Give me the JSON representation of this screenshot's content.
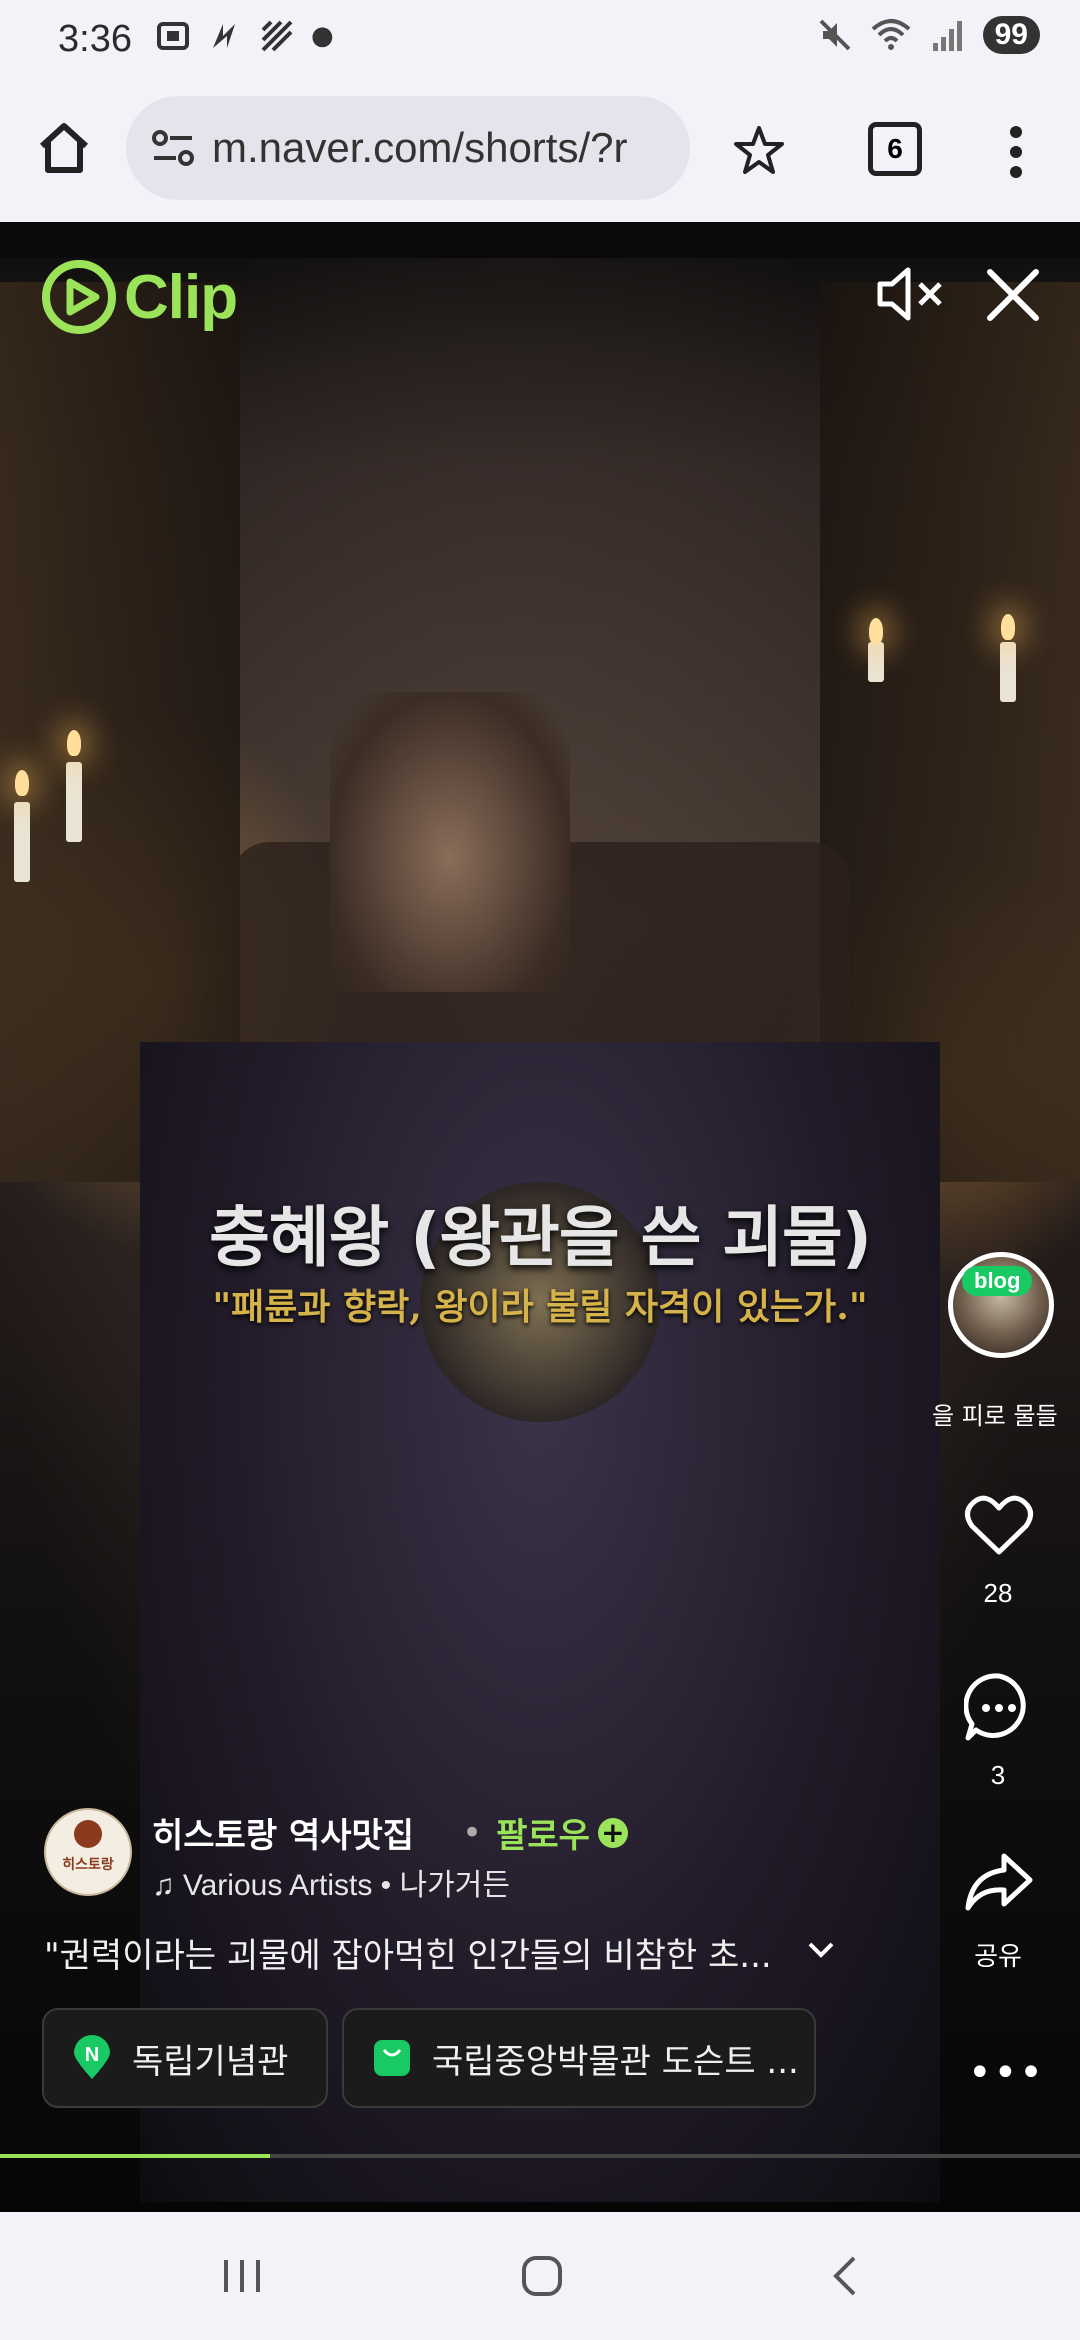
{
  "status_bar": {
    "time": "3:36",
    "battery": "99"
  },
  "browser": {
    "url": "m.naver.com/shorts/?r",
    "tab_count": "6"
  },
  "video": {
    "logo_text": "Clip",
    "overlay_title": "충혜왕 (왕관을 쓴 괴물)",
    "overlay_subtitle": "\"패륜과 향락, 왕이라 불릴 자격이 있는가.\"",
    "progress_percent": 25
  },
  "rail": {
    "blog_badge": "blog",
    "blog_caption": "을 피로 물들",
    "like_count": "28",
    "comment_count": "3",
    "share_label": "공유"
  },
  "channel": {
    "name": "히스토랑 역사맛집",
    "separator": "•",
    "follow_label": "팔로우",
    "avatar_text": "히스토랑",
    "music": "Various Artists • 나가거든"
  },
  "description": "\"권력이라는 괴물에 잡아먹힌 인간들의 비참한 초...",
  "chips": [
    {
      "label": "독립기념관",
      "icon": "map-pin-icon",
      "color": "#18c964"
    },
    {
      "label": "국립중앙박물관 도슨트 ...",
      "icon": "shopping-bag-icon",
      "color": "#18c964"
    }
  ],
  "colors": {
    "accent": "#9be45a",
    "subtitle_gold": "#d5b24a",
    "naver_green": "#18c964"
  }
}
